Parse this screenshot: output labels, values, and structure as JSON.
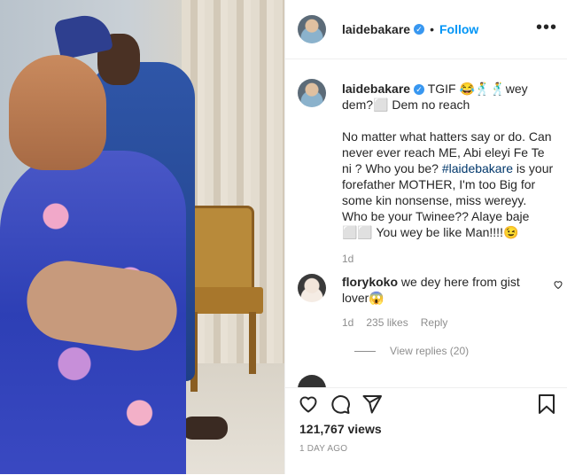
{
  "post": {
    "username": "laidebakare",
    "verified_mark": "✓",
    "dot": "•",
    "follow_label": "Follow",
    "more_label": "•••"
  },
  "caption": {
    "username": "laidebakare",
    "line1": "TGIF 😂🕺🕺wey dem?⬜ Dem no reach",
    "line2_pre": "No matter what hatters say or do. Can never ever reach ME, Abi eleyi Fe Te ni ? Who you be? ",
    "hashtag": "#laidebakare",
    "line2_post": " is your forefather MOTHER, I'm too Big for some kin nonsense, miss wereyy. Who be your Twinee?? Alaye baje ⬜⬜ You wey be like Man!!!!😉",
    "time": "1d"
  },
  "comment": {
    "username": "florykoko",
    "text": "we dey here from gist lover😱",
    "time": "1d",
    "likes": "235 likes",
    "reply_label": "Reply",
    "view_replies": "View replies (20)"
  },
  "actions": {
    "views": "121,767 views",
    "posted": "1 DAY AGO"
  },
  "icons": [
    "heart-icon",
    "comment-icon",
    "share-icon",
    "bookmark-icon",
    "more-icon",
    "verified-icon"
  ],
  "colors": {
    "link_blue": "#0095f6",
    "verified_blue": "#3897f0",
    "muted_text": "#8e8e8e",
    "text": "#262626"
  }
}
